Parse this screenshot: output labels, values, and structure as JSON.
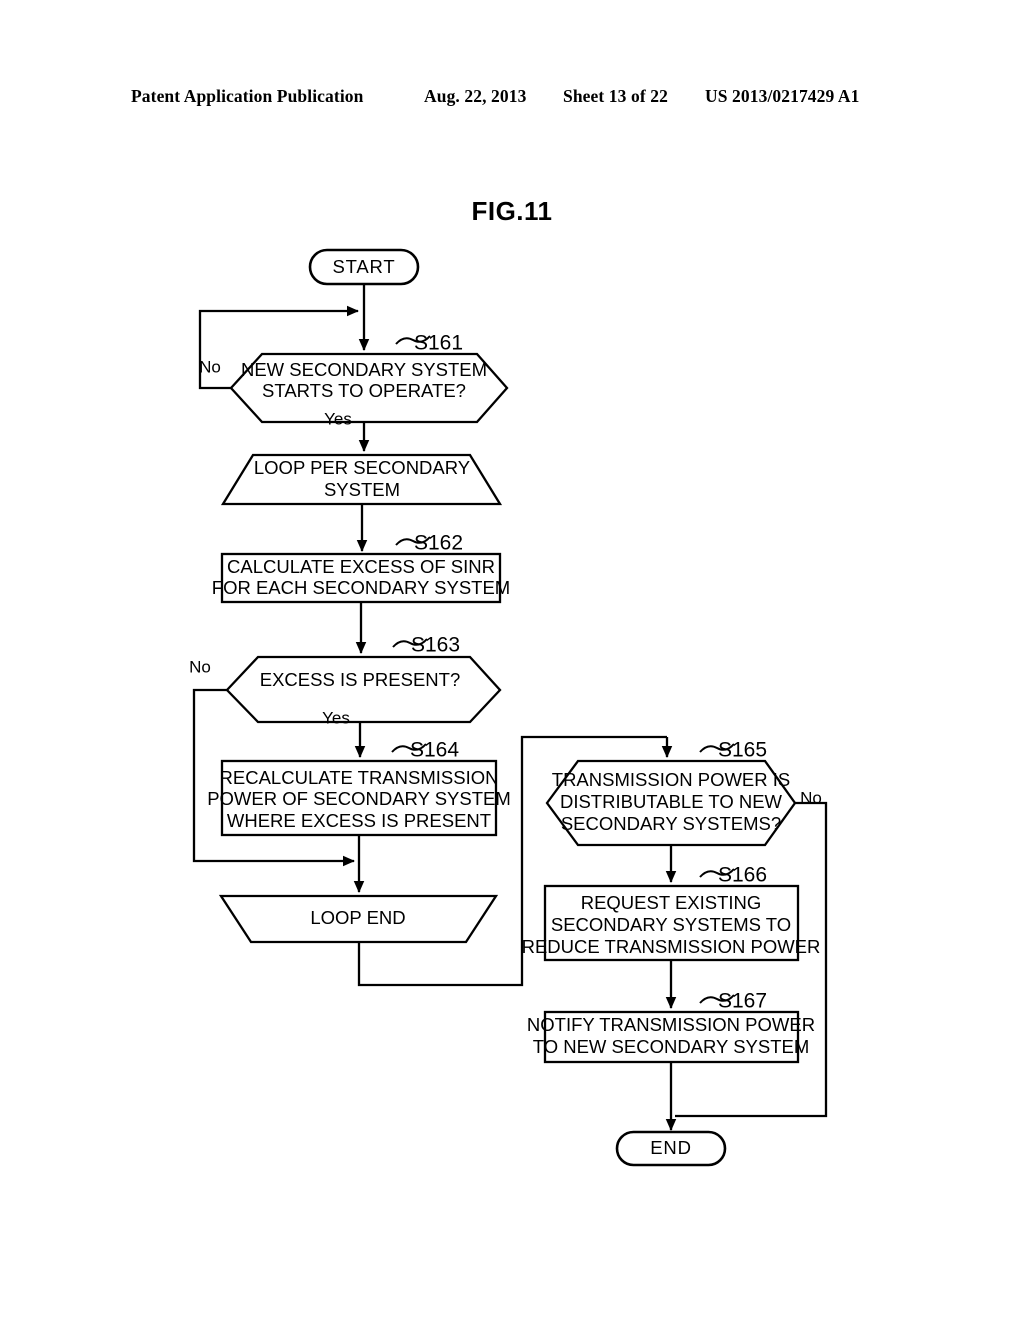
{
  "header": {
    "publication": "Patent Application Publication",
    "date": "Aug. 22, 2013",
    "sheet": "Sheet 13 of 22",
    "number": "US 2013/0217429 A1"
  },
  "figure": {
    "title": "FIG.11"
  },
  "flowchart": {
    "nodes": {
      "start": {
        "label": "START",
        "type": "terminator"
      },
      "s161": {
        "step": "S161",
        "type": "decision",
        "lines": [
          "NEW SECONDARY SYSTEM",
          "STARTS TO OPERATE?"
        ],
        "yes": "Yes",
        "no": "No"
      },
      "loop_start": {
        "type": "loop-begin",
        "lines": [
          "LOOP PER SECONDARY",
          "SYSTEM"
        ]
      },
      "s162": {
        "step": "S162",
        "type": "process",
        "lines": [
          "CALCULATE EXCESS OF SINR",
          "FOR EACH SECONDARY SYSTEM"
        ]
      },
      "s163": {
        "step": "S163",
        "type": "decision",
        "lines": [
          "EXCESS IS PRESENT?"
        ],
        "yes": "Yes",
        "no": "No"
      },
      "s164": {
        "step": "S164",
        "type": "process",
        "lines": [
          "RECALCULATE TRANSMISSION",
          "POWER OF SECONDARY SYSTEM",
          "WHERE EXCESS IS PRESENT"
        ]
      },
      "loop_end": {
        "type": "loop-end",
        "lines": [
          "LOOP END"
        ]
      },
      "s165": {
        "step": "S165",
        "type": "decision",
        "lines": [
          "TRANSMISSION POWER IS",
          "DISTRIBUTABLE TO NEW",
          "SECONDARY SYSTEMS?"
        ],
        "no": "No"
      },
      "s166": {
        "step": "S166",
        "type": "process",
        "lines": [
          "REQUEST EXISTING",
          "SECONDARY SYSTEMS TO",
          "REDUCE TRANSMISSION POWER"
        ]
      },
      "s167": {
        "step": "S167",
        "type": "process",
        "lines": [
          "NOTIFY TRANSMISSION POWER",
          "TO NEW SECONDARY SYSTEM"
        ]
      },
      "end": {
        "label": "END",
        "type": "terminator"
      }
    }
  }
}
